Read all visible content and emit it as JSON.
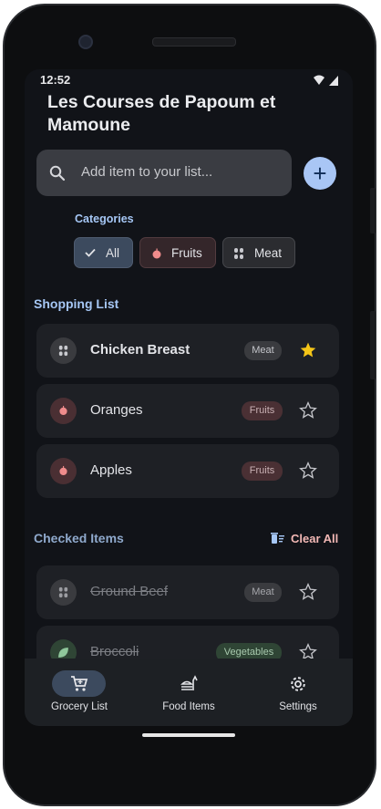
{
  "status_bar": {
    "time": "12:52"
  },
  "app": {
    "title": "Les Courses de Papoum et Mamoune"
  },
  "search": {
    "placeholder": "Add item to your list..."
  },
  "categories": {
    "label": "Categories",
    "chips": [
      {
        "label": "All",
        "icon": "check-icon",
        "selected": true
      },
      {
        "label": "Fruits",
        "icon": "apple-icon",
        "selected": false
      },
      {
        "label": "Meat",
        "icon": "meat-icon",
        "selected": false
      }
    ]
  },
  "shopping_list": {
    "title": "Shopping List",
    "items": [
      {
        "name": "Chicken Breast",
        "category": "Meat",
        "favorite": true
      },
      {
        "name": "Oranges",
        "category": "Fruits",
        "favorite": false
      },
      {
        "name": "Apples",
        "category": "Fruits",
        "favorite": false
      }
    ]
  },
  "checked_items": {
    "title": "Checked Items",
    "clear_label": "Clear All",
    "items": [
      {
        "name": "Ground Beef",
        "category": "Meat",
        "favorite": false
      },
      {
        "name": "Broccoli",
        "category": "Vegetables",
        "favorite": false
      }
    ]
  },
  "bottom_nav": {
    "items": [
      {
        "label": "Grocery List",
        "icon": "cart-icon",
        "active": true
      },
      {
        "label": "Food Items",
        "icon": "food-icon",
        "active": false
      },
      {
        "label": "Settings",
        "icon": "gear-icon",
        "active": false
      }
    ]
  },
  "colors": {
    "accent": "#a6c7f5",
    "background": "#111318",
    "card": "#1e2025",
    "favorite": "#f5c518",
    "danger": "#f2b8b5"
  }
}
